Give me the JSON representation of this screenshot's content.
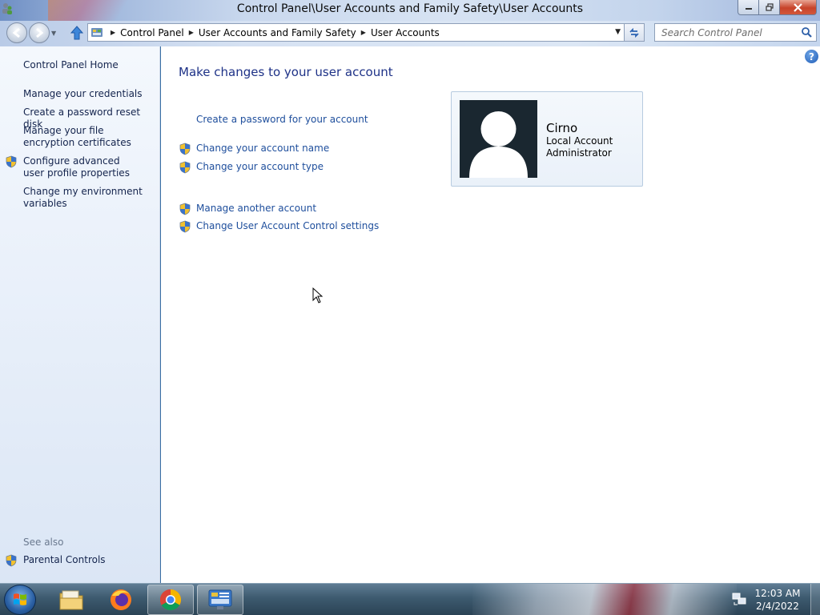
{
  "window": {
    "title": "Control Panel\\User Accounts and Family Safety\\User Accounts"
  },
  "address_bar": {
    "breadcrumbs": [
      "Control Panel",
      "User Accounts and Family Safety",
      "User Accounts"
    ]
  },
  "search": {
    "placeholder": "Search Control Panel"
  },
  "sidebar": {
    "home": "Control Panel Home",
    "links": [
      "Manage your credentials",
      "Create a password reset disk",
      "Manage your file encryption certificates",
      "Configure advanced user profile properties",
      "Change my environment variables"
    ],
    "see_also": "See also",
    "see_also_links": [
      "Parental Controls"
    ]
  },
  "main": {
    "heading": "Make changes to your user account",
    "tasks": [
      "Create a password for your account",
      "Change your account name",
      "Change your account type",
      "Manage another account",
      "Change User Account Control settings"
    ],
    "help_label": "?"
  },
  "user": {
    "name": "Cirno",
    "account_type": "Local Account",
    "role": "Administrator"
  },
  "taskbar": {
    "apps": [
      "file-explorer",
      "firefox",
      "chrome",
      "control-panel"
    ],
    "time": "12:03 AM",
    "date": "2/4/2022"
  },
  "colors": {
    "link": "#1e4e9c",
    "heading": "#1e3287",
    "sidebar_text": "#14244d"
  }
}
